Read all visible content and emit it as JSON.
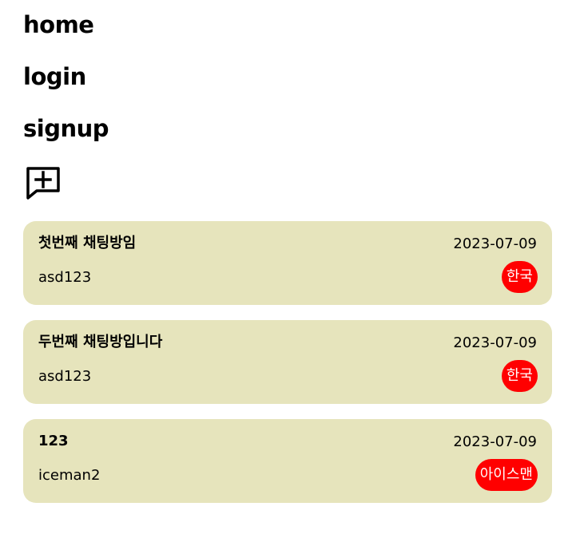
{
  "nav": {
    "home": "home",
    "login": "login",
    "signup": "signup"
  },
  "new_chat_icon": "message-plus-icon",
  "rooms": [
    {
      "title": "첫번째 채팅방임",
      "date": "2023-07-09",
      "user": "asd123",
      "badge": "한국"
    },
    {
      "title": "두번째 채팅방입니다",
      "date": "2023-07-09",
      "user": "asd123",
      "badge": "한국"
    },
    {
      "title": "123",
      "date": "2023-07-09",
      "user": "iceman2",
      "badge": "아이스맨"
    }
  ],
  "colors": {
    "card_bg": "#e6e4bc",
    "badge_bg": "#ff0000",
    "badge_text": "#ffffff"
  }
}
